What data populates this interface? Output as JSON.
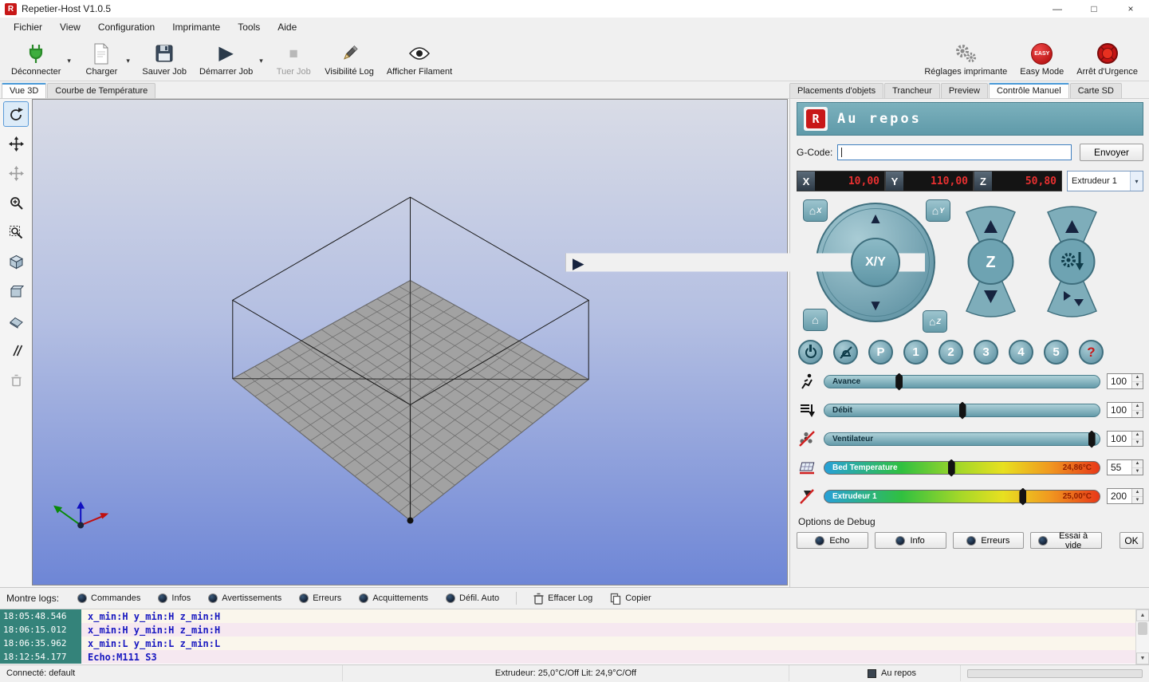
{
  "colors": {
    "accent_teal": "#6aa5b2",
    "header_teal": "#5f9aa9",
    "danger_red": "#c81818",
    "value_red": "#e83030",
    "log_time_bg": "#34837a",
    "viewport_gradient_top": "#d9dce6",
    "viewport_gradient_bottom": "#6e86d6"
  },
  "window": {
    "title": "Repetier-Host V1.0.5",
    "minimize": "—",
    "maximize": "□",
    "close": "×"
  },
  "menu": {
    "items": [
      "Fichier",
      "View",
      "Configuration",
      "Imprimante",
      "Tools",
      "Aide"
    ]
  },
  "toolbar": {
    "buttons": [
      {
        "label": "Déconnecter"
      },
      {
        "label": "Charger"
      },
      {
        "label": "Sauver Job"
      },
      {
        "label": "Démarrer Job"
      },
      {
        "label": "Tuer Job"
      },
      {
        "label": "Visibilité Log"
      },
      {
        "label": "Afficher Filament"
      }
    ],
    "printer_settings": "Réglages imprimante",
    "easy_mode": "Easy Mode",
    "easy_badge": "EASY",
    "emergency": "Arrêt d'Urgence"
  },
  "tabs": {
    "left": [
      "Vue 3D",
      "Courbe de Température"
    ],
    "left_active": "Vue 3D",
    "right": [
      "Placements d'objets",
      "Trancheur",
      "Preview",
      "Contrôle Manuel",
      "Carte SD"
    ],
    "right_active": "Contrôle Manuel"
  },
  "manual_control": {
    "status": "Au repos",
    "gcode_label": "G-Code:",
    "gcode_value": "",
    "send_button": "Envoyer",
    "position": {
      "x_label": "X",
      "x_value": "10,00",
      "y_label": "Y",
      "y_value": "110,00",
      "z_label": "Z",
      "z_value": "50,80"
    },
    "extruder_select": "Extrudeur 1",
    "pad": {
      "xy_label": "X/Y",
      "z_label": "Z"
    },
    "home": {
      "x": "X",
      "y": "Y",
      "z": "Z"
    },
    "quick_buttons": {
      "park": "P",
      "b1": "1",
      "b2": "2",
      "b3": "3",
      "b4": "4",
      "b5": "5",
      "help": "?"
    },
    "sliders": [
      {
        "label": "Avance",
        "value": "100"
      },
      {
        "label": "Débit",
        "value": "100"
      },
      {
        "label": "Ventilateur",
        "value": "100"
      },
      {
        "label": "Bed Temperature",
        "value": "55",
        "current": "24,86°C"
      },
      {
        "label": "Extrudeur 1",
        "value": "200",
        "current": "25,00°C"
      }
    ],
    "debug": {
      "title": "Options de Debug",
      "options": [
        "Echo",
        "Info",
        "Erreurs",
        "Essai à vide"
      ],
      "ok": "OK"
    }
  },
  "log": {
    "label": "Montre logs:",
    "filters": [
      "Commandes",
      "Infos",
      "Avertissements",
      "Erreurs",
      "Acquittements",
      "Défil. Auto"
    ],
    "clear_label": "Effacer Log",
    "copy_label": "Copier",
    "rows": [
      {
        "time": "18:05:48.546",
        "message": "x_min:H y_min:H z_min:H"
      },
      {
        "time": "18:06:15.012",
        "message": "x_min:H y_min:H z_min:H"
      },
      {
        "time": "18:06:35.962",
        "message": "x_min:L y_min:L z_min:L"
      },
      {
        "time": "18:12:54.177",
        "message": "Echo:M111  S3"
      }
    ]
  },
  "statusbar": {
    "connection": "Connecté: default",
    "temps": "Extrudeur: 25,0°C/Off Lit: 24,9°C/Off",
    "state": "Au repos"
  },
  "icons": {
    "dropdown": "▾",
    "up": "▲",
    "down": "▼",
    "left": "◀",
    "right": "▶",
    "play": "▶",
    "stop": "■",
    "spin_up": "▲",
    "spin_down": "▼",
    "scroll_up": "▲",
    "scroll_down": "▼"
  }
}
